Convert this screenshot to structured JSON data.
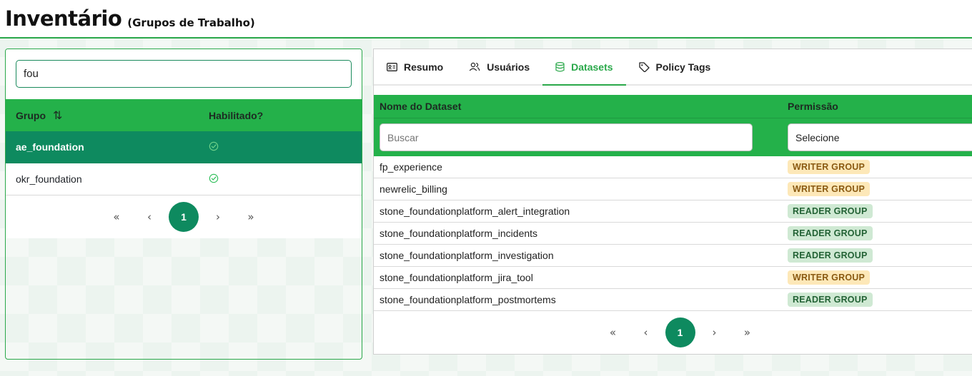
{
  "header": {
    "title": "Inventário",
    "subtitle": "(Grupos de Trabalho)"
  },
  "left": {
    "search_value": "fou",
    "columns": {
      "group": "Grupo",
      "enabled": "Habilitado?"
    },
    "rows": [
      {
        "name": "ae_foundation",
        "enabled": true,
        "selected": true
      },
      {
        "name": "okr_foundation",
        "enabled": true,
        "selected": false
      }
    ],
    "pager": {
      "first": "«",
      "prev": "‹",
      "current": "1",
      "next": "›",
      "last": "»"
    }
  },
  "right": {
    "tabs": [
      {
        "label": "Resumo",
        "icon": "id-card-icon"
      },
      {
        "label": "Usuários",
        "icon": "users-icon"
      },
      {
        "label": "Datasets",
        "icon": "database-icon",
        "active": true
      },
      {
        "label": "Policy Tags",
        "icon": "tag-icon"
      }
    ],
    "columns": {
      "dataset": "Nome do Dataset",
      "permission": "Permissão"
    },
    "filter": {
      "search_placeholder": "Buscar",
      "select_value": "Selecione"
    },
    "rows": [
      {
        "name": "fp_experience",
        "permission": "WRITER GROUP",
        "kind": "writer"
      },
      {
        "name": "newrelic_billing",
        "permission": "WRITER GROUP",
        "kind": "writer"
      },
      {
        "name": "stone_foundationplatform_alert_integration",
        "permission": "READER GROUP",
        "kind": "reader"
      },
      {
        "name": "stone_foundationplatform_incidents",
        "permission": "READER GROUP",
        "kind": "reader"
      },
      {
        "name": "stone_foundationplatform_investigation",
        "permission": "READER GROUP",
        "kind": "reader"
      },
      {
        "name": "stone_foundationplatform_jira_tool",
        "permission": "WRITER GROUP",
        "kind": "writer"
      },
      {
        "name": "stone_foundationplatform_postmortems",
        "permission": "READER GROUP",
        "kind": "reader"
      }
    ],
    "pager": {
      "first": "«",
      "prev": "‹",
      "current": "1",
      "next": "›",
      "last": "»"
    }
  },
  "colors": {
    "accent_green": "#24b14a",
    "selected_green": "#0e8a5f",
    "writer_badge_bg": "#fde8b8",
    "reader_badge_bg": "#cfe9d3"
  }
}
